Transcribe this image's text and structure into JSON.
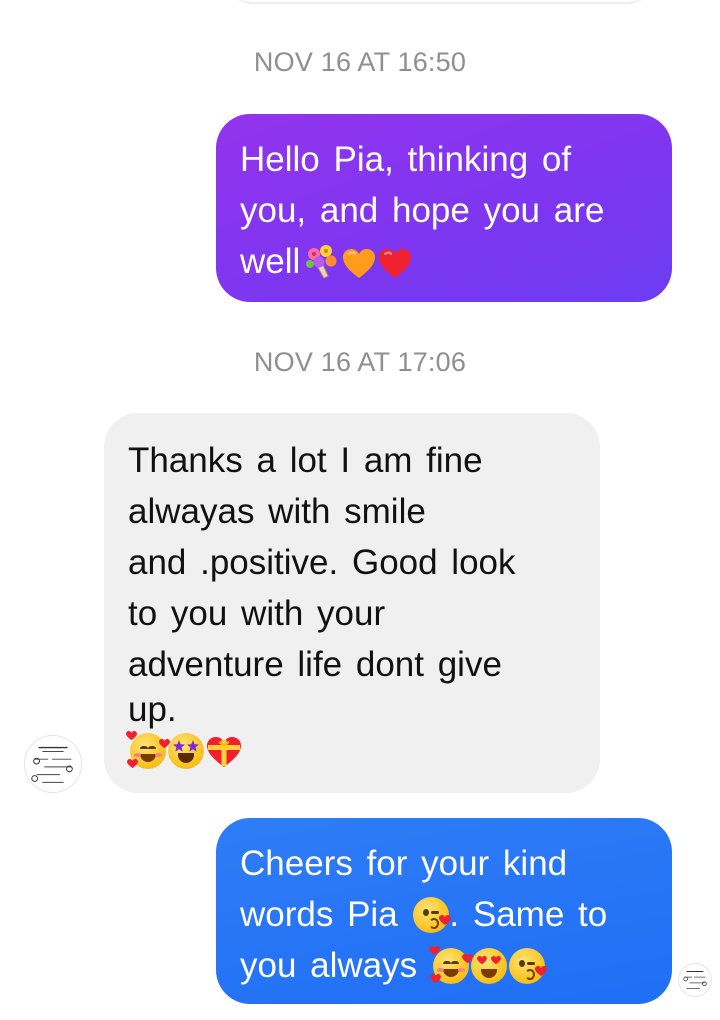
{
  "thread": {
    "timestamps": [
      "NOV 16 AT 16:50",
      "NOV 16 AT 17:06"
    ],
    "messages": [
      {
        "direction": "outgoing",
        "lines": [
          "Hello Pia, thinking of",
          "you,  and hope you are",
          "well"
        ],
        "trailing_emoji": [
          "bouquet-icon",
          "orange-heart-icon",
          "red-heart-icon"
        ],
        "colors": {
          "gradient_start": "#9334ee",
          "gradient_end": "#6c3df2",
          "text": "#ffffff"
        }
      },
      {
        "direction": "incoming",
        "lines": [
          "Thanks  a  lot    I  am  fine",
          "alwayas  with  smile",
          "and .positive.  Good  look",
          "to  you with  your",
          "adventure  life dont  give",
          "up."
        ],
        "trailing_emoji": [
          "smiling-face-with-hearts-icon",
          "star-struck-icon",
          "heart-with-ribbon-icon"
        ],
        "colors": {
          "background": "#f0f0f0",
          "text": "#111111"
        }
      },
      {
        "direction": "outgoing",
        "line1": "Cheers for your kind",
        "line2_start": "words Pia",
        "line2_end": ". Same to",
        "line3": "you always",
        "trailing_emoji": [
          "smiling-face-with-hearts-icon",
          "heart-eyes-icon",
          "kissing-face-icon"
        ],
        "colors": {
          "gradient_start": "#2f7cf6",
          "gradient_end": "#1f6ff5",
          "text": "#ffffff"
        }
      }
    ],
    "timestamp_color": "#8e8e93"
  }
}
